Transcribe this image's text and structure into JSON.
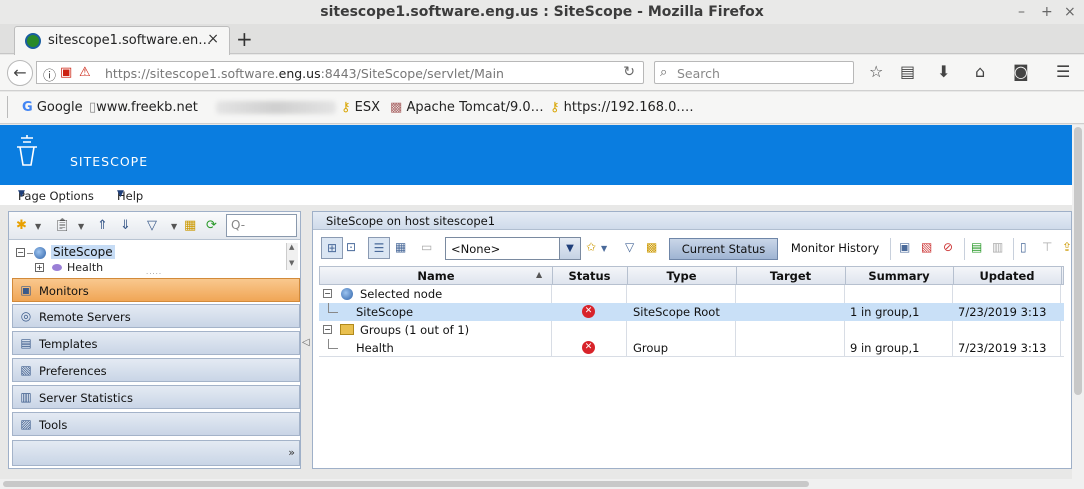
{
  "window": {
    "title": "sitescope1.software.eng.us : SiteScope - Mozilla Firefox"
  },
  "browser": {
    "tab_title": "sitescope1.software.en…",
    "url_prefix": "https://sitescope1.software.",
    "url_domain": "eng.us",
    "url_suffix": ":8443/SiteScope/servlet/Main",
    "search_placeholder": "Search",
    "bookmarks": [
      {
        "label": "Google",
        "icon": "google-icon"
      },
      {
        "label": "www.freekb.net",
        "icon": "page-icon"
      },
      {
        "label": "ESX",
        "icon": "key-icon"
      },
      {
        "label": "Apache Tomcat/9.0…",
        "icon": "tomcat-icon"
      },
      {
        "label": "https://192.168.0.…",
        "icon": "key-icon"
      }
    ]
  },
  "app": {
    "brand": "SITESCOPE",
    "menu": {
      "page_options": "Page Options",
      "help": "Help"
    },
    "tree": {
      "root": "SiteScope",
      "child": "Health",
      "search_placeholder": "Q-"
    },
    "nav": [
      {
        "label": "Monitors",
        "icon": "monitors-icon",
        "active": true
      },
      {
        "label": "Remote Servers",
        "icon": "remote-servers-icon",
        "active": false
      },
      {
        "label": "Templates",
        "icon": "templates-icon",
        "active": false
      },
      {
        "label": "Preferences",
        "icon": "preferences-icon",
        "active": false
      },
      {
        "label": "Server Statistics",
        "icon": "server-statistics-icon",
        "active": false
      },
      {
        "label": "Tools",
        "icon": "tools-icon",
        "active": false
      }
    ],
    "content": {
      "title": "SiteScope on host sitescope1",
      "view_select": "<None>",
      "current_status": "Current Status",
      "monitor_history": "Monitor History",
      "columns": [
        "Name",
        "Status",
        "Type",
        "Target",
        "Summary",
        "Updated"
      ],
      "rows": [
        {
          "kind": "group",
          "name": "Selected node"
        },
        {
          "kind": "item",
          "name": "SiteScope",
          "status": "error",
          "type": "SiteScope Root",
          "target": "",
          "summary": "1 in group,1",
          "updated": "7/23/2019 3:13",
          "selected": true
        },
        {
          "kind": "group",
          "name": "Groups (1 out of 1)"
        },
        {
          "kind": "item",
          "name": "Health",
          "status": "error",
          "type": "Group",
          "target": "",
          "summary": "9 in group,1",
          "updated": "7/23/2019 3:13",
          "selected": false
        }
      ]
    }
  },
  "colors": {
    "header_blue": "#0a7de0",
    "active_nav": "#f0a656",
    "error": "#d8232a",
    "selection": "#c9e0f7"
  }
}
